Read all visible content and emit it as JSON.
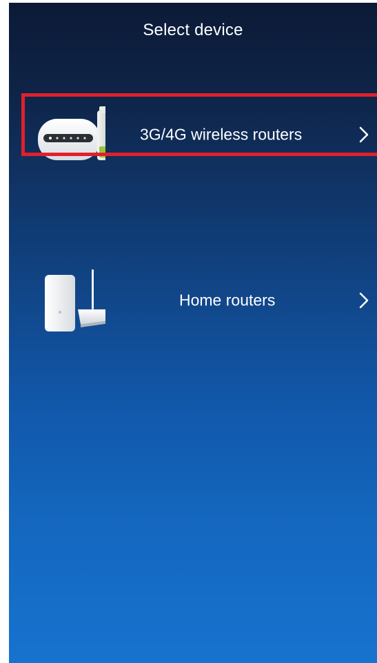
{
  "header": {
    "title": "Select device"
  },
  "devices": [
    {
      "label": "3G/4G wireless routers",
      "icon": "mobile-wifi-router-icon",
      "chevron": "chevron-right-icon"
    },
    {
      "label": "Home routers",
      "icon": "home-router-icon",
      "chevron": "chevron-right-icon"
    }
  ],
  "colors": {
    "background_top": "#0c1a36",
    "background_bottom": "#1773cf",
    "text": "#ffffff",
    "highlight_border": "#e0202c"
  }
}
